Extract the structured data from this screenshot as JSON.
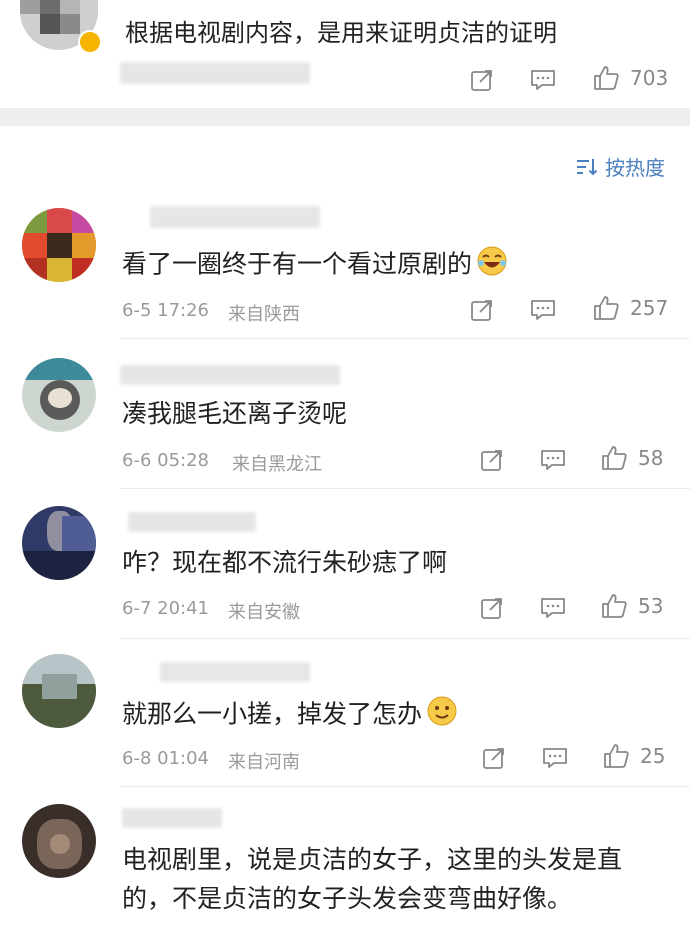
{
  "top": {
    "text": "根据电视剧内容，是用来证明贞洁的证明",
    "likes": "703"
  },
  "sort": {
    "label": "按热度"
  },
  "comments": [
    {
      "text": "看了一圈终于有一个看过原剧的",
      "time": "6-5 17:26",
      "location": "来自陕西",
      "likes": "257"
    },
    {
      "text": "凑我腿毛还离子烫呢",
      "time": "6-6 05:28",
      "location": "来自黑龙江",
      "likes": "58"
    },
    {
      "text": "咋？现在都不流行朱砂痣了啊",
      "time": "6-7 20:41",
      "location": "来自安徽",
      "likes": "53"
    },
    {
      "text": "就那么一小搓，掉发了怎办",
      "time": "6-8 01:04",
      "location": "来自河南",
      "likes": "25"
    },
    {
      "text": "电视剧里，说是贞洁的女子，这里的头发是直",
      "text2": "的，不是贞洁的女子头发会变弯曲好像。"
    }
  ],
  "colors": {
    "accent": "#4a7fc1",
    "separator": "#eeeeee",
    "meta": "#9a9a9a"
  }
}
